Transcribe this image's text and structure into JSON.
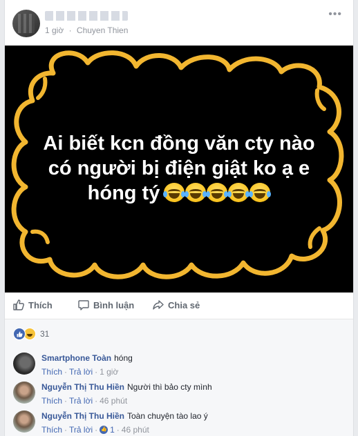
{
  "post": {
    "time": "1 giờ",
    "separator": "·",
    "place": "Chuyen Thien",
    "more_glyph": "•••",
    "photo_text_line1": "Ai biết kcn đồng văn cty nào",
    "photo_text_line2": "có người bị điện giật ko ạ e",
    "photo_text_line3": "hóng tý",
    "photo_bg": "#000000",
    "cloud_color": "#f2b630"
  },
  "actions": {
    "like_label": "Thích",
    "comment_label": "Bình luận",
    "share_label": "Chia sẻ"
  },
  "reactions": {
    "count": "31",
    "like_icon": "like-reaction-icon",
    "haha_icon": "haha-reaction-icon"
  },
  "comments": [
    {
      "name": "Smartphone Toàn",
      "text": "hóng",
      "like": "Thích",
      "reply": "Trả lời",
      "time": "1 giờ"
    },
    {
      "name": "Nguyễn Thị Thu Hiền",
      "text": "Người thì bảo cty mình",
      "like": "Thích",
      "reply": "Trả lời",
      "time": "46 phút"
    },
    {
      "name": "Nguyễn Thị Thu Hiền",
      "text": "Toàn chuyện tào lao ý",
      "like": "Thích",
      "reply": "Trả lời",
      "likes": "1",
      "time": "46 phút"
    }
  ],
  "colors": {
    "link_blue": "#385898",
    "action_gray": "#606770",
    "meta_gray": "#90949c",
    "like_blue": "#4267b2"
  }
}
